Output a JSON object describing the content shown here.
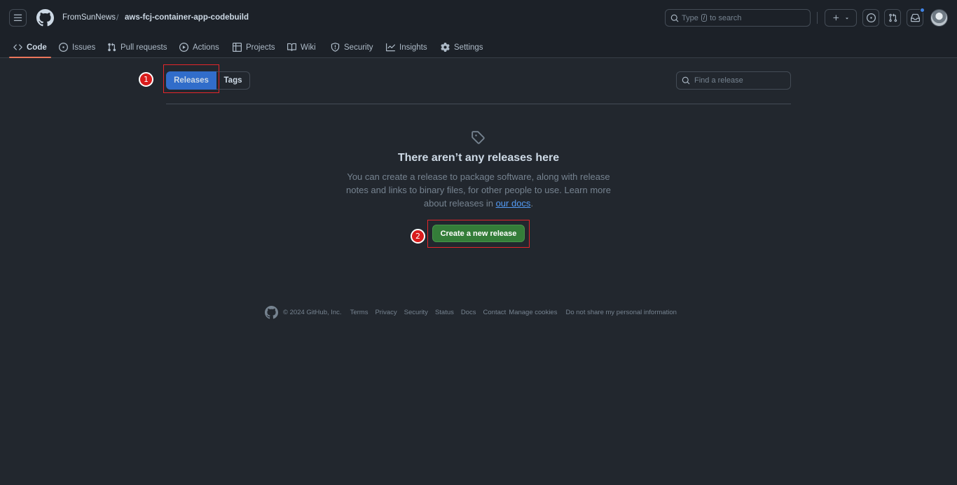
{
  "header": {
    "owner": "FromSunNews",
    "separator": "/",
    "repo": "aws-fcj-container-app-codebuild",
    "search_before": "Type",
    "search_key": "/",
    "search_after": "to search",
    "plus_label": "+"
  },
  "nav": [
    {
      "label": "Code",
      "icon": "code-icon",
      "active": true
    },
    {
      "label": "Issues",
      "icon": "issue-icon"
    },
    {
      "label": "Pull requests",
      "icon": "pull-request-icon"
    },
    {
      "label": "Actions",
      "icon": "play-icon"
    },
    {
      "label": "Projects",
      "icon": "table-icon"
    },
    {
      "label": "Wiki",
      "icon": "book-icon"
    },
    {
      "label": "Security",
      "icon": "shield-icon"
    },
    {
      "label": "Insights",
      "icon": "graph-icon"
    },
    {
      "label": "Settings",
      "icon": "gear-icon"
    }
  ],
  "subnav": {
    "releases_label": "Releases",
    "tags_label": "Tags",
    "find_placeholder": "Find a release"
  },
  "empty_state": {
    "icon": "tag-icon",
    "title": "There aren’t any releases here",
    "description_prefix": "You can create a release to package software, along with release notes and links to binary files, for other people to use. Learn more about releases in",
    "docs_link": "our docs",
    "description_suffix": ".",
    "create_button": "Create a new release"
  },
  "annotations": {
    "step1": "1",
    "step2": "2",
    "box_color": "#e5252a"
  },
  "footer": {
    "copyright": "© 2024 GitHub, Inc.",
    "links": [
      "Terms",
      "Privacy",
      "Security",
      "Status",
      "Docs",
      "Contact",
      "Manage cookies",
      "Do not share my personal information"
    ]
  },
  "colors": {
    "background": "#22272e",
    "header_bg": "#1c2128",
    "accent_blue": "#316dca",
    "button_green": "#347d39",
    "active_tab_underline": "#ec775c",
    "notification_dot": "#4184e4"
  }
}
